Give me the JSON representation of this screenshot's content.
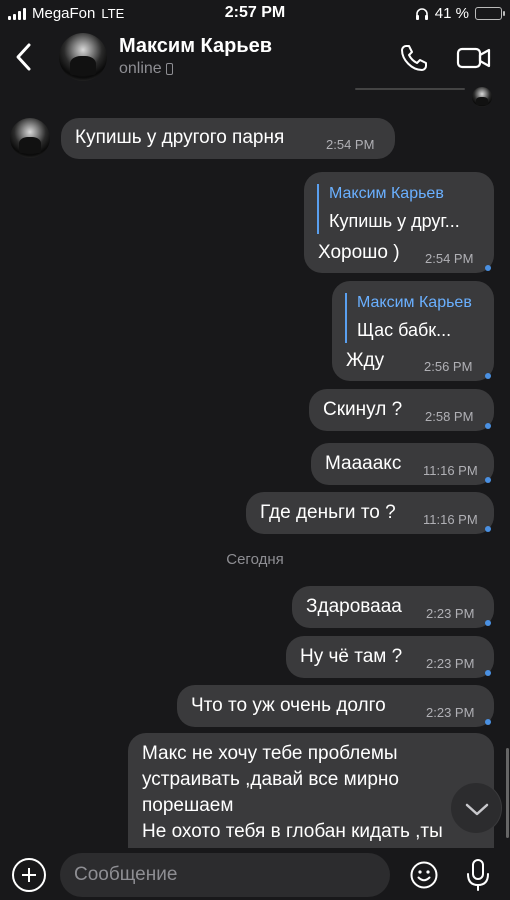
{
  "status_bar": {
    "carrier": "MegaFon",
    "network": "LTE",
    "time": "2:57 PM",
    "battery_label": "41 %",
    "battery_level": 0.41,
    "battery_color": "#f5c518"
  },
  "header": {
    "name": "Максим Карьев",
    "presence": "online",
    "icons": {
      "back": "chevron-left-icon",
      "call": "phone-icon",
      "video": "video-camera-icon"
    }
  },
  "messages": [
    {
      "side": "in",
      "text": "Купишь у другого парня",
      "time": "2:54 PM"
    },
    {
      "side": "out",
      "quote": {
        "author": "Максим Карьев",
        "text": "Купишь у друг..."
      },
      "text": "Хорошо )",
      "time": "2:54 PM"
    },
    {
      "side": "out",
      "quote": {
        "author": "Максим Карьев",
        "text": "Щас бабк..."
      },
      "text": "Жду",
      "time": "2:56 PM"
    },
    {
      "side": "out",
      "text": "Скинул ?",
      "time": "2:58 PM"
    },
    {
      "side": "out",
      "text": "Маааакс",
      "time": "11:16 PM"
    },
    {
      "side": "out",
      "text": "Где деньги то ?",
      "time": "11:16 PM"
    },
    {
      "side": "out",
      "text": "Здаровааа",
      "time": "2:23 PM"
    },
    {
      "side": "out",
      "text": "Ну чё там ?",
      "time": "2:23 PM"
    },
    {
      "side": "out",
      "text": "Что то уж очень долго",
      "time": "2:23 PM"
    },
    {
      "side": "out",
      "lines": [
        "Макс не хочу тебе проблемы",
        "устраивать ,давай все мирно",
        "порешаем",
        "Не охото тебя в глобан кидать ,ты"
      ]
    }
  ],
  "date_separator": "Сегодня",
  "input": {
    "placeholder": "Сообщение"
  },
  "colors": {
    "background": "#18181a",
    "bubble": "#3a3a3c",
    "accent": "#5aa0f0",
    "read_dot": "#4a90e2"
  }
}
